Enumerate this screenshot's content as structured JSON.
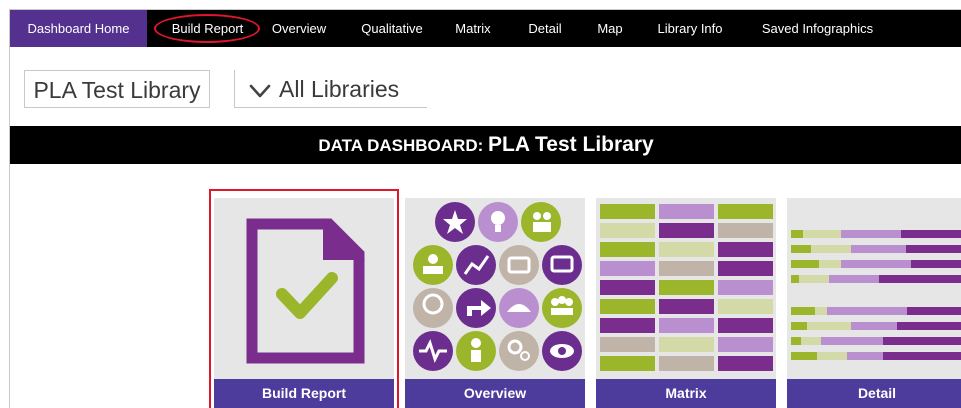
{
  "nav": {
    "items": [
      {
        "label": "Dashboard Home",
        "active": true
      },
      {
        "label": "Build Report",
        "active": false
      },
      {
        "label": "Overview",
        "active": false
      },
      {
        "label": "Qualitative",
        "active": false
      },
      {
        "label": "Matrix",
        "active": false
      },
      {
        "label": "Detail",
        "active": false
      },
      {
        "label": "Map",
        "active": false
      },
      {
        "label": "Library Info",
        "active": false
      },
      {
        "label": "Saved Infographics",
        "active": false
      }
    ]
  },
  "selectors": {
    "library": "PLA Test Library",
    "comparison": "All Libraries"
  },
  "banner": {
    "prefix": "DATA DASHBOARD: ",
    "library": "PLA Test Library"
  },
  "tiles": [
    {
      "label": "Build Report",
      "icon": "document-check-icon"
    },
    {
      "label": "Overview",
      "icon": "overview-icons-grid"
    },
    {
      "label": "Matrix",
      "icon": "matrix-grid-icon"
    },
    {
      "label": "Detail",
      "icon": "detail-bars-icon"
    }
  ],
  "colors": {
    "nav_bg": "#000000",
    "nav_active": "#55318f",
    "highlight": "#e0162b",
    "tile_label": "#4e3c9c",
    "purple": "#7b2d8e",
    "lime": "#9bb62a",
    "light_purple": "#b98fcf",
    "tan": "#c0b3a8"
  }
}
